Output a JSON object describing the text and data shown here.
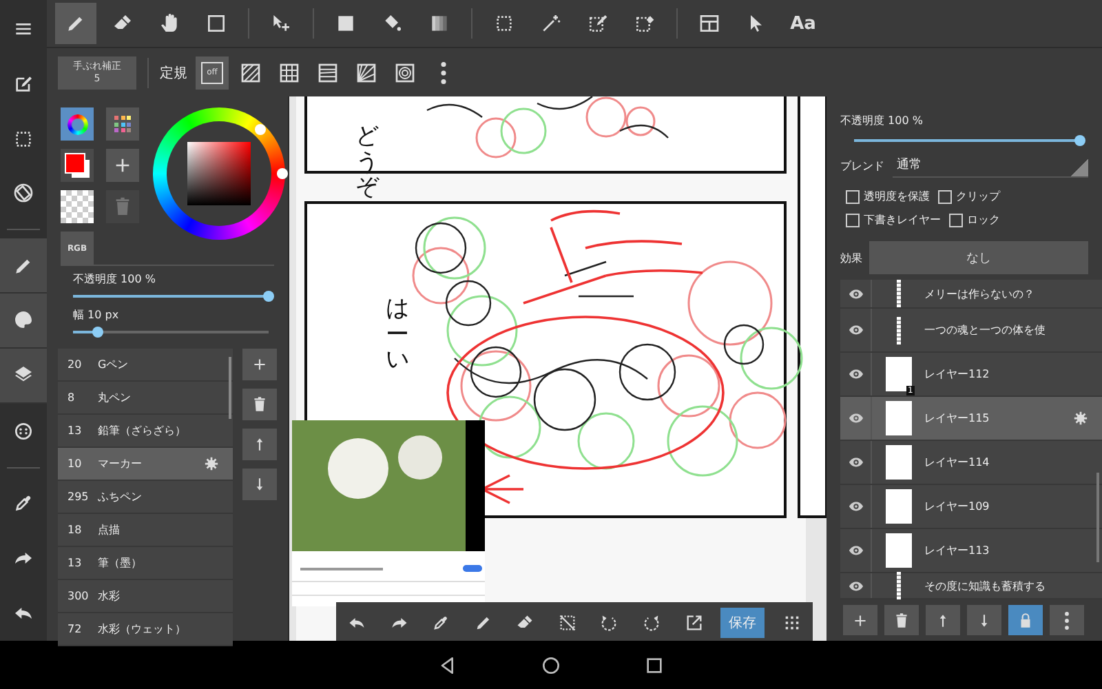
{
  "rail": {
    "groups": [
      {
        "items": [
          {
            "kind": "menu",
            "on": false
          },
          {
            "kind": "edit",
            "on": false
          },
          {
            "kind": "select",
            "on": false
          },
          {
            "kind": "rotate",
            "on": false
          }
        ]
      },
      {
        "items": [
          {
            "kind": "pen",
            "on": true
          },
          {
            "kind": "palette",
            "on": true
          },
          {
            "kind": "layers",
            "on": true
          },
          {
            "kind": "material",
            "on": false
          }
        ]
      },
      {
        "items": [
          {
            "kind": "eyedropper",
            "on": false
          },
          {
            "kind": "redo",
            "on": false
          },
          {
            "kind": "undo",
            "on": false
          }
        ]
      }
    ]
  },
  "toolbar": {
    "groups": [
      {
        "tools": [
          {
            "kind": "pen",
            "selected": true
          },
          {
            "kind": "eraser",
            "selected": false
          },
          {
            "kind": "hand",
            "selected": false
          },
          {
            "kind": "square",
            "selected": false
          }
        ]
      },
      {
        "tools": [
          {
            "kind": "move",
            "selected": false
          }
        ]
      },
      {
        "tools": [
          {
            "kind": "fillrect",
            "selected": false
          },
          {
            "kind": "bucket",
            "selected": false
          },
          {
            "kind": "gradient",
            "selected": false
          }
        ]
      },
      {
        "tools": [
          {
            "kind": "select",
            "selected": false
          },
          {
            "kind": "wand",
            "selected": false
          },
          {
            "kind": "selpen",
            "selected": false
          },
          {
            "kind": "seleraser",
            "selected": false
          }
        ]
      },
      {
        "tools": [
          {
            "kind": "layout",
            "selected": false
          },
          {
            "kind": "pointer",
            "selected": false
          },
          {
            "kind": "text",
            "label": "Aa",
            "selected": false
          }
        ]
      }
    ]
  },
  "subbar": {
    "stabilizer": {
      "label": "手ぶれ補正",
      "value": "5"
    },
    "ruler_label": "定規",
    "rulers": [
      {
        "kind": "off",
        "label": "off",
        "selected": true
      },
      {
        "kind": "parallel",
        "selected": false
      },
      {
        "kind": "grid",
        "selected": false
      },
      {
        "kind": "horizontal",
        "selected": false
      },
      {
        "kind": "radial",
        "selected": false
      },
      {
        "kind": "concentric",
        "selected": false
      }
    ]
  },
  "color_panel": {
    "modes": [
      {
        "kind": "wheel",
        "selected": true
      },
      {
        "kind": "swatches",
        "selected": false
      }
    ],
    "swatches": [
      {
        "color": "#ffffff"
      },
      {
        "color": "#ff0000"
      }
    ],
    "delete_disabled": true,
    "rgb": "RGB"
  },
  "brush_sliders": [
    {
      "label": "不透明度 100 %",
      "level": 1.0
    },
    {
      "label": "幅 10 px",
      "level": 0.13
    }
  ],
  "brushes": [
    {
      "size": "20",
      "name": "Gペン",
      "selected": false
    },
    {
      "size": "8",
      "name": "丸ペン",
      "selected": false
    },
    {
      "size": "13",
      "name": "鉛筆（ざらざら）",
      "selected": false
    },
    {
      "size": "10",
      "name": "マーカー",
      "selected": true
    },
    {
      "size": "295",
      "name": "ふちペン",
      "selected": false
    },
    {
      "size": "18",
      "name": "点描",
      "selected": false
    },
    {
      "size": "13",
      "name": "筆（墨）",
      "selected": false
    },
    {
      "size": "300",
      "name": "水彩",
      "selected": false
    },
    {
      "size": "72",
      "name": "水彩（ウェット）",
      "selected": false
    }
  ],
  "brush_actions": [
    {
      "kind": "plus"
    },
    {
      "kind": "trash"
    },
    {
      "kind": "up"
    },
    {
      "kind": "down"
    }
  ],
  "canvas": {
    "texts": [
      "どうぞ",
      "はーい"
    ]
  },
  "floating_toolbar": {
    "tools": [
      {
        "kind": "undo"
      },
      {
        "kind": "redo"
      },
      {
        "kind": "eyedropper"
      },
      {
        "kind": "pen"
      },
      {
        "kind": "eraser"
      },
      {
        "kind": "deselect"
      },
      {
        "kind": "rotccw"
      },
      {
        "kind": "rotcw"
      },
      {
        "kind": "export"
      },
      {
        "kind": "save",
        "label": "保存"
      },
      {
        "kind": "grid"
      }
    ]
  },
  "layer_panel": {
    "opacity": {
      "label": "不透明度 100 %",
      "level": 1.0
    },
    "blend": {
      "label": "ブレンド",
      "value": "通常"
    },
    "options": [
      {
        "label": "透明度を保護",
        "checked": false
      },
      {
        "label": "クリップ",
        "checked": false
      },
      {
        "label": "下書きレイヤー",
        "checked": false
      },
      {
        "label": "ロック",
        "checked": false
      }
    ],
    "effect": {
      "label": "効果",
      "value": "なし"
    },
    "layers": [
      {
        "kind": "text",
        "name": "メリーは作らないの？",
        "selected": false
      },
      {
        "kind": "text",
        "name": "一つの魂と一つの体を使",
        "selected": false
      },
      {
        "kind": "image",
        "name": "レイヤー112",
        "badge": "1",
        "selected": false
      },
      {
        "kind": "image",
        "name": "レイヤー115",
        "selected": true
      },
      {
        "kind": "image",
        "name": "レイヤー114",
        "selected": false
      },
      {
        "kind": "image",
        "name": "レイヤー109",
        "selected": false
      },
      {
        "kind": "image",
        "name": "レイヤー113",
        "selected": false
      },
      {
        "kind": "text",
        "name": "その度に知識も蓄積する",
        "selected": false
      }
    ],
    "actions": [
      {
        "kind": "plus",
        "on": false
      },
      {
        "kind": "trash",
        "on": false
      },
      {
        "kind": "up",
        "on": false
      },
      {
        "kind": "down",
        "on": false
      },
      {
        "kind": "lock",
        "on": true
      },
      {
        "kind": "more",
        "on": false
      }
    ]
  },
  "nav": [
    {
      "kind": "back"
    },
    {
      "kind": "home"
    },
    {
      "kind": "recents"
    }
  ]
}
